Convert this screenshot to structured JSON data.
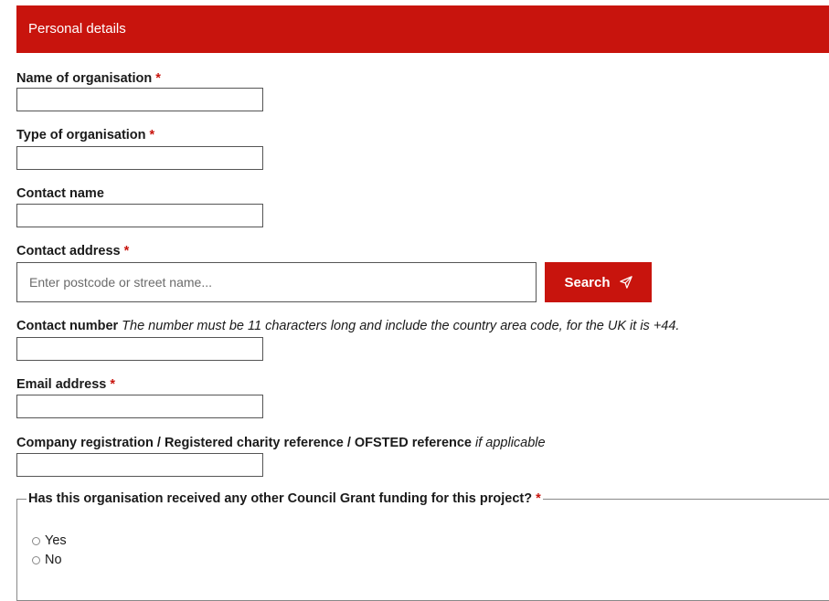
{
  "section": {
    "title": "Personal details"
  },
  "fields": {
    "org_name": {
      "label": "Name of organisation",
      "required": "*"
    },
    "org_type": {
      "label": "Type of organisation",
      "required": "*"
    },
    "contact_name": {
      "label": "Contact name"
    },
    "contact_address": {
      "label": "Contact address",
      "required": "*",
      "placeholder": "Enter postcode or street name..."
    },
    "contact_number": {
      "label": "Contact number",
      "hint": "The number must be 11 characters long and include the country area code, for the UK it is +44."
    },
    "email": {
      "label": "Email address",
      "required": "*"
    },
    "company_ref": {
      "label": "Company registration / Registered charity reference / OFSTED reference",
      "hint": "if applicable"
    }
  },
  "search_button": {
    "label": "Search",
    "icon": "send-icon"
  },
  "funding_question": {
    "legend": "Has this organisation received any other Council Grant funding for this project?",
    "required": "*",
    "options": [
      "Yes",
      "No"
    ]
  },
  "colors": {
    "brand_red": "#c8140d"
  }
}
